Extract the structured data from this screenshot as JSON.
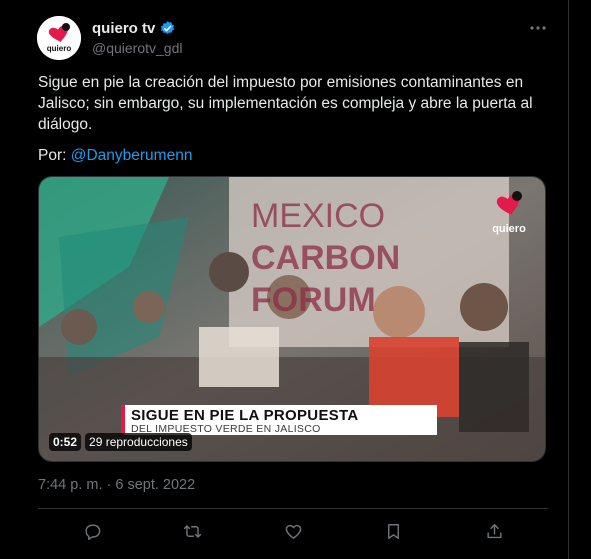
{
  "author": {
    "display_name": "quiero tv",
    "handle": "@quierotv_gdl",
    "verified": true,
    "avatar_icon": "quiero-logo",
    "avatar_text": "quiero"
  },
  "tweet": {
    "text": "Sigue en pie la creación del impuesto por emisiones contaminantes en Jalisco; sin embargo, su implementación es compleja y abre la puerta al diálogo.",
    "byline_prefix": "Por: ",
    "mention": "@Danyberumenn",
    "timestamp": "7:44 p. m. · 6 sept. 2022"
  },
  "media": {
    "backdrop_lines": [
      "MEXICO",
      "CARBON",
      "FORUM"
    ],
    "logo_text": "quiero",
    "lower_third_title": "SIGUE EN PIE LA PROPUESTA",
    "lower_third_subtitle": "DEL IMPUESTO VERDE EN JALISCO",
    "duration": "0:52",
    "views": "29 reproducciones"
  },
  "actions": [
    {
      "icon": "reply-icon"
    },
    {
      "icon": "retweet-icon"
    },
    {
      "icon": "like-icon"
    },
    {
      "icon": "bookmark-icon"
    },
    {
      "icon": "share-icon"
    }
  ],
  "colors": {
    "background": "#000000",
    "text": "#e7e9ea",
    "muted": "#71767b",
    "link": "#1d9bf0",
    "verified": "#1d9bf0",
    "brand": "#e31b4b"
  }
}
